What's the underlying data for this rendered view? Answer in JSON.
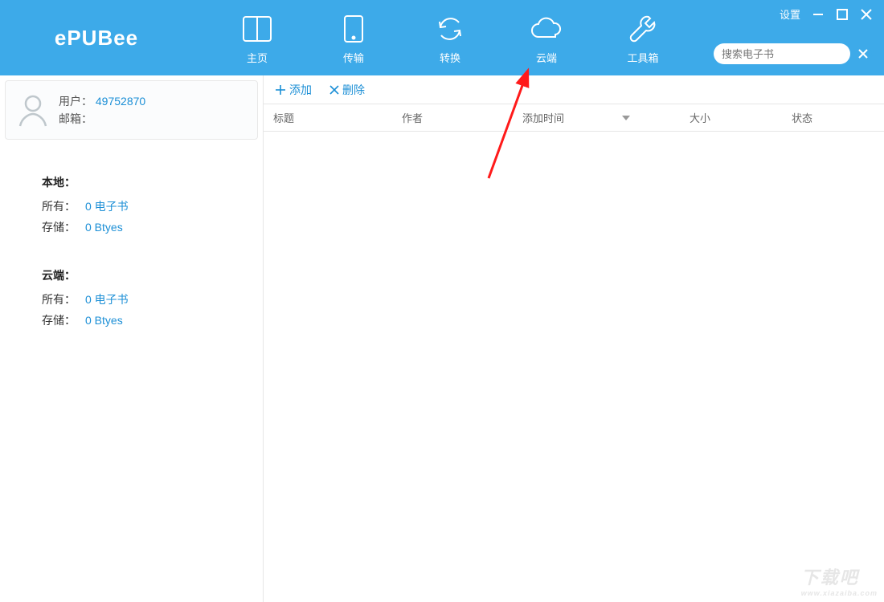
{
  "app": {
    "name": "ePUBee"
  },
  "titlebar": {
    "settings": "设置"
  },
  "nav": {
    "home": "主页",
    "transfer": "传输",
    "convert": "转换",
    "cloud": "云端",
    "tools": "工具箱"
  },
  "search": {
    "placeholder": "搜索电子书"
  },
  "user": {
    "user_label": "用户：",
    "user_id": "49752870",
    "email_label": "邮箱：",
    "email_value": ""
  },
  "stats": {
    "local": {
      "title": "本地：",
      "all_label": "所有：",
      "all_value": "0 电子书",
      "storage_label": "存储：",
      "storage_value": "0 Btyes"
    },
    "cloud": {
      "title": "云端：",
      "all_label": "所有：",
      "all_value": "0 电子书",
      "storage_label": "存储：",
      "storage_value": "0 Btyes"
    }
  },
  "actions": {
    "add": "添加",
    "delete": "删除"
  },
  "columns": {
    "title": "标题",
    "author": "作者",
    "added": "添加时间",
    "size": "大小",
    "status": "状态"
  },
  "watermark": {
    "text": "下载吧",
    "url": "www.xiazaiba.com"
  }
}
